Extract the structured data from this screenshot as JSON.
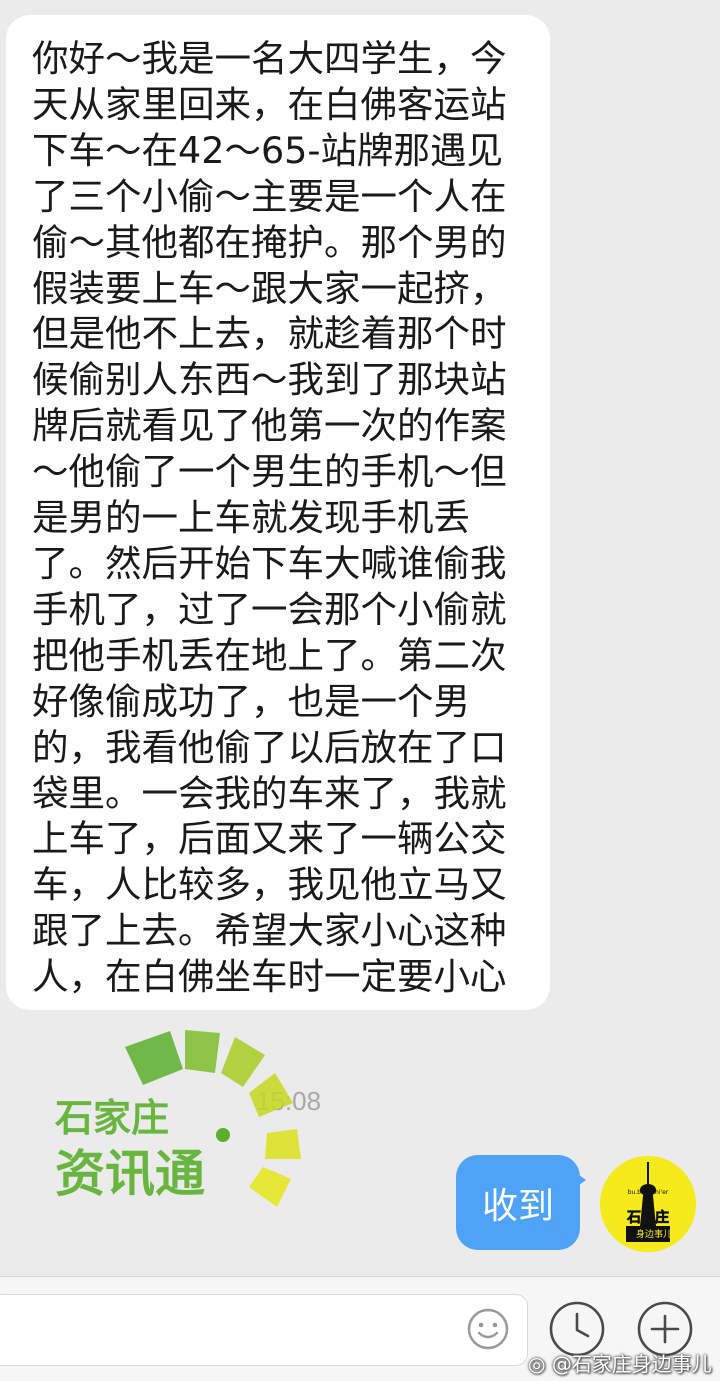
{
  "conversation": {
    "incoming_message": "你好～我是一名大四学生，今天从家里回来，在白佛客运站下车～在42～65-站牌那遇见了三个小偷～主要是一个人在偷～其他都在掩护。那个男的假装要上车～跟大家一起挤，但是他不上去，就趁着那个时候偷别人东西～我到了那块站牌后就看见了他第一次的作案～他偷了一个男生的手机～但是男的一上车就发现手机丢了。然后开始下车大喊谁偷我手机了，过了一会那个小偷就把他手机丢在地上了。第二次好像偷成功了，也是一个男的，我看他偷了以后放在了口袋里。一会我的车来了，我就上车了，后面又来了一辆公交车，人比较多，我见他立马又跟了上去。希望大家小心这种人，在白佛坐车时一定要小心",
    "timestamp": "15:08",
    "outgoing_message": "收到"
  },
  "overlay_logo": {
    "line1": "石家庄",
    "line2": "资讯通"
  },
  "avatar": {
    "top_text": "bu.b'an'shi'er",
    "main_text": "石家庄",
    "sub_text": "身边事儿"
  },
  "input_bar": {
    "placeholder": "",
    "emoji_icon": "smiley-face-icon",
    "clock_icon": "clock-icon",
    "plus_icon": "plus-icon"
  },
  "watermark": {
    "text": "@石家庄身边事儿"
  },
  "colors": {
    "background": "#ebebeb",
    "incoming_bubble": "#ffffff",
    "outgoing_bubble": "#4fa3f7",
    "avatar_bg": "#f5ea1c",
    "logo_green": "#5ab02d",
    "logo_yellow": "#e6e617"
  }
}
